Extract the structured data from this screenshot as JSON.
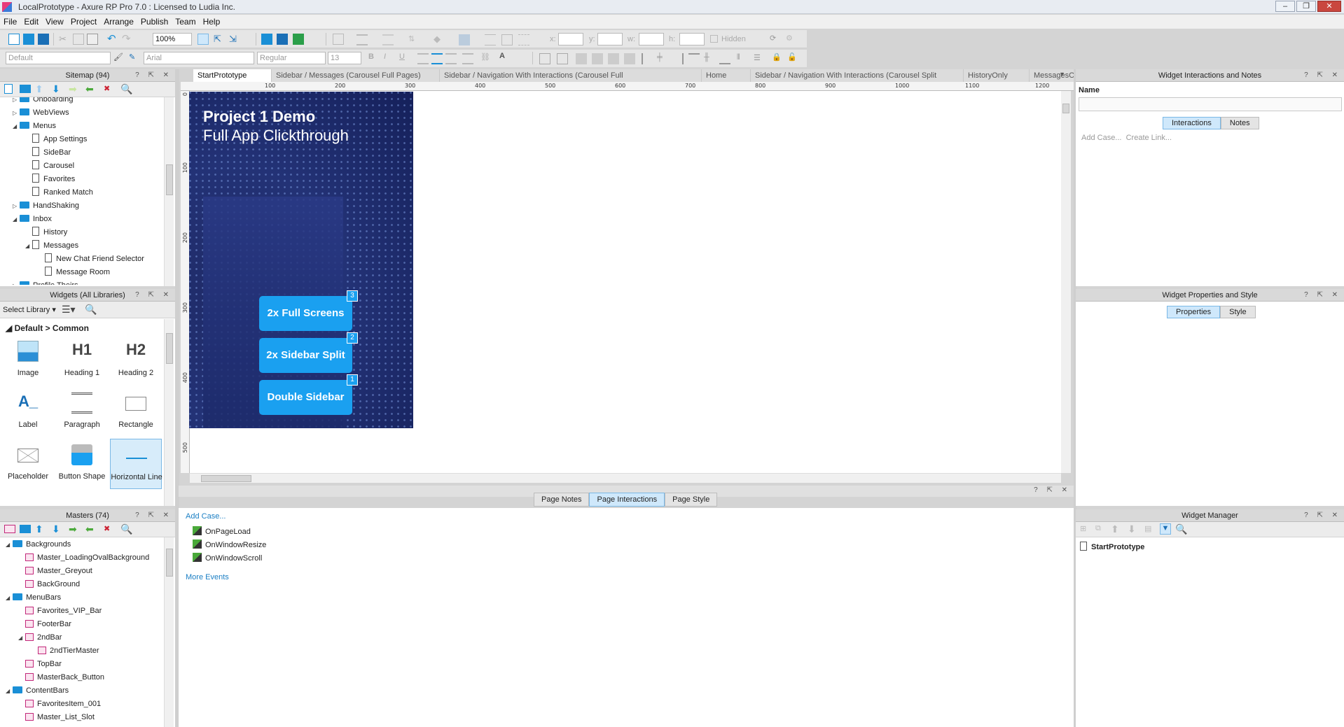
{
  "window": {
    "title": "LocalPrototype - Axure RP Pro 7.0 : Licensed to Ludia Inc."
  },
  "menu": [
    "File",
    "Edit",
    "View",
    "Project",
    "Arrange",
    "Publish",
    "Team",
    "Help"
  ],
  "toolbar": {
    "zoom": "100%",
    "font_style_placeholder": "Default",
    "font_family": "Arial",
    "font_weight": "Regular",
    "font_size": "13",
    "x_label": "x:",
    "y_label": "y:",
    "w_label": "w:",
    "h_label": "h:",
    "hidden_label": "Hidden"
  },
  "sitemap": {
    "title": "Sitemap (94)",
    "items": [
      {
        "label": "Onboarding",
        "type": "folder",
        "level": 1,
        "expanded": false
      },
      {
        "label": "WebViews",
        "type": "folder",
        "level": 1,
        "expanded": false
      },
      {
        "label": "Menus",
        "type": "folder",
        "level": 1,
        "expanded": true
      },
      {
        "label": "App Settings",
        "type": "page",
        "level": 2
      },
      {
        "label": "SideBar",
        "type": "page",
        "level": 2
      },
      {
        "label": "Carousel",
        "type": "page",
        "level": 2
      },
      {
        "label": "Favorites",
        "type": "page",
        "level": 2
      },
      {
        "label": "Ranked Match",
        "type": "page",
        "level": 2
      },
      {
        "label": "HandShaking",
        "type": "folder",
        "level": 1,
        "expanded": false
      },
      {
        "label": "Inbox",
        "type": "folder",
        "level": 1,
        "expanded": true
      },
      {
        "label": "History",
        "type": "page",
        "level": 2
      },
      {
        "label": "Messages",
        "type": "page",
        "level": 2,
        "expanded": true
      },
      {
        "label": "New Chat Friend Selector",
        "type": "page",
        "level": 3
      },
      {
        "label": "Message Room",
        "type": "page",
        "level": 3
      },
      {
        "label": "Profile Theirs",
        "type": "folder",
        "level": 1
      }
    ]
  },
  "widgets": {
    "title": "Widgets (All Libraries)",
    "select_library": "Select Library",
    "group": "Default > Common",
    "items": [
      {
        "label": "Image",
        "icon": "image-icon"
      },
      {
        "label": "Heading 1",
        "icon": "heading1-icon",
        "glyph": "H1"
      },
      {
        "label": "Heading 2",
        "icon": "heading2-icon",
        "glyph": "H2"
      },
      {
        "label": "Label",
        "icon": "label-icon",
        "glyph": "A_"
      },
      {
        "label": "Paragraph",
        "icon": "paragraph-icon"
      },
      {
        "label": "Rectangle",
        "icon": "rectangle-icon"
      },
      {
        "label": "Placeholder",
        "icon": "placeholder-icon"
      },
      {
        "label": "Button Shape",
        "icon": "button-shape-icon"
      },
      {
        "label": "Horizontal Line",
        "icon": "horizontal-line-icon",
        "selected": true
      }
    ]
  },
  "masters": {
    "title": "Masters (74)",
    "items": [
      {
        "label": "Backgrounds",
        "type": "folder",
        "level": 1
      },
      {
        "label": "Master_LoadingOvalBackground",
        "type": "master",
        "level": 2
      },
      {
        "label": "Master_Greyout",
        "type": "master",
        "level": 2
      },
      {
        "label": "BackGround",
        "type": "master",
        "level": 2
      },
      {
        "label": "MenuBars",
        "type": "folder",
        "level": 1
      },
      {
        "label": "Favorites_VIP_Bar",
        "type": "master",
        "level": 2
      },
      {
        "label": "FooterBar",
        "type": "master",
        "level": 2
      },
      {
        "label": "2ndBar",
        "type": "master",
        "level": 2,
        "expanded": true
      },
      {
        "label": "2ndTierMaster",
        "type": "master",
        "level": 3
      },
      {
        "label": "TopBar",
        "type": "master",
        "level": 2
      },
      {
        "label": "MasterBack_Button",
        "type": "master",
        "level": 2
      },
      {
        "label": "ContentBars",
        "type": "folder",
        "level": 1
      },
      {
        "label": "FavoritesItem_001",
        "type": "master",
        "level": 2
      },
      {
        "label": "Master_List_Slot",
        "type": "master",
        "level": 2
      }
    ]
  },
  "tabs": [
    {
      "label": "StartPrototype",
      "active": true
    },
    {
      "label": "Sidebar / Messages (Carousel Full Pages)"
    },
    {
      "label": "Sidebar / Navigation With Interactions (Carousel Full"
    },
    {
      "label": "Home"
    },
    {
      "label": "Sidebar / Navigation With Interactions (Carousel Split"
    },
    {
      "label": "HistoryOnly"
    },
    {
      "label": "MessagesOnly"
    }
  ],
  "ruler": {
    "h": [
      "100",
      "200",
      "300",
      "400",
      "500",
      "600",
      "700",
      "800",
      "900",
      "1000",
      "1100",
      "1200"
    ],
    "v": [
      "0",
      "100",
      "200",
      "300",
      "400",
      "500"
    ]
  },
  "artboard": {
    "title": "Project 1 Demo",
    "subtitle": "Full App Clickthrough",
    "buttons": [
      {
        "label": "2x Full Screens",
        "badge": "3"
      },
      {
        "label": "2x Sidebar Split",
        "badge": "2"
      },
      {
        "label": "Double Sidebar",
        "badge": "1"
      }
    ]
  },
  "page_panel": {
    "tabs": [
      "Page Notes",
      "Page Interactions",
      "Page Style"
    ],
    "active_tab": "Page Interactions",
    "add_case": "Add Case...",
    "events": [
      "OnPageLoad",
      "OnWindowResize",
      "OnWindowScroll"
    ],
    "more_events": "More Events"
  },
  "widget_interactions": {
    "title": "Widget Interactions and Notes",
    "name_label": "Name",
    "tabs": [
      "Interactions",
      "Notes"
    ],
    "add_case": "Add Case...",
    "create_link": "Create Link..."
  },
  "widget_properties": {
    "title": "Widget Properties and Style",
    "tabs": [
      "Properties",
      "Style"
    ]
  },
  "widget_manager": {
    "title": "Widget Manager",
    "item": "StartPrototype"
  },
  "colors": {
    "accent": "#1aa0f0",
    "artboard_bg": "#1f2a66",
    "link": "#1b7fc4"
  }
}
